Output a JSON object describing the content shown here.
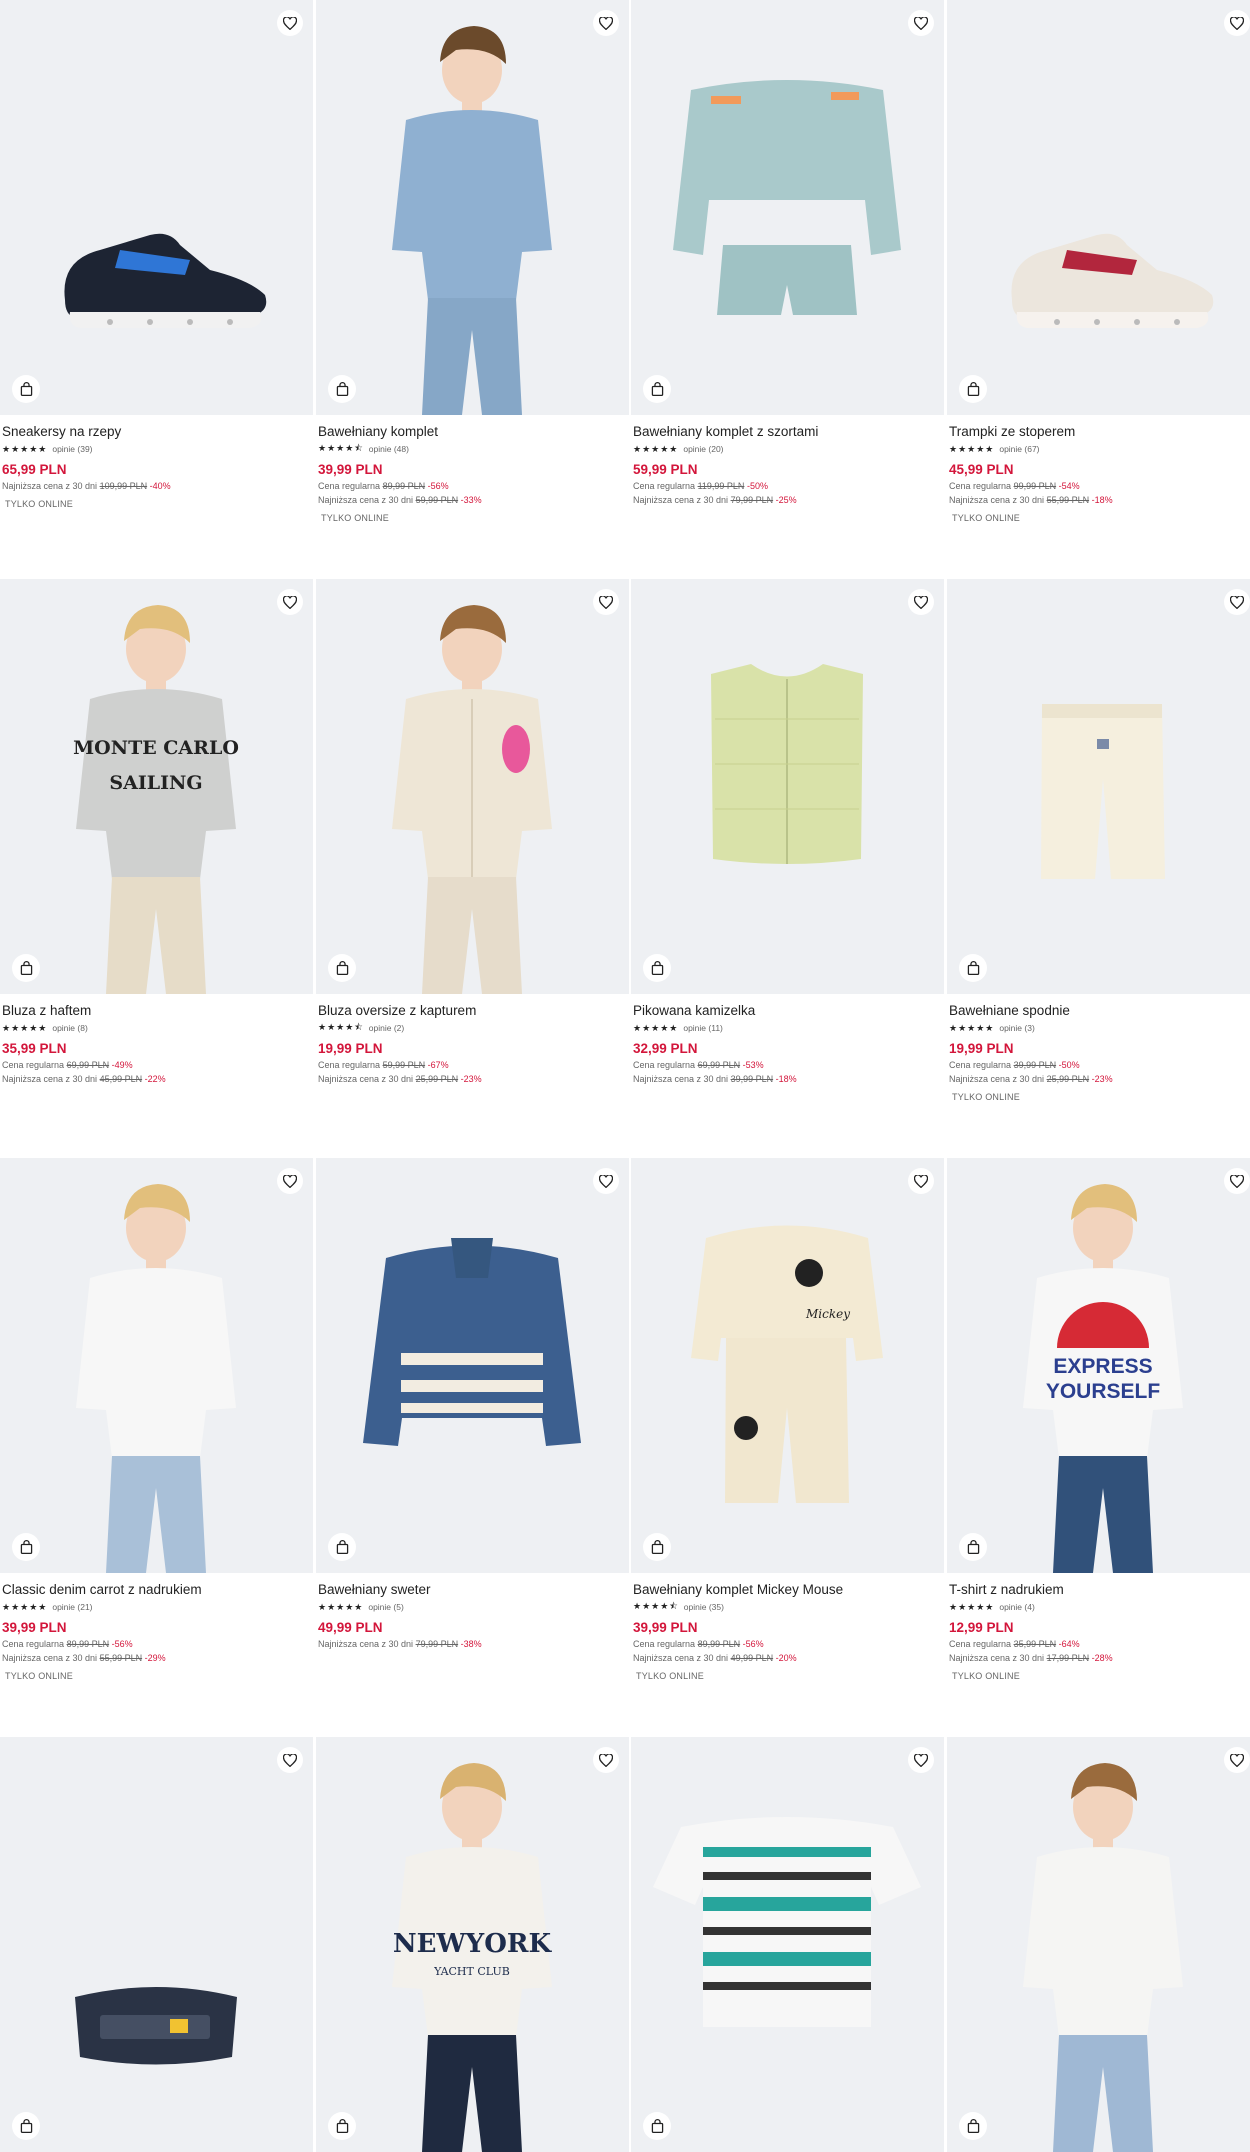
{
  "products": [
    {
      "title": "Sneakersy na rzepy",
      "stars": "★★★★★",
      "reviews": "opinie (39)",
      "price": "65,99 PLN",
      "regular_label": "",
      "regular_old": "",
      "regular_disc": "",
      "lowest_label": "Najniższa cena z 30 dni",
      "lowest_old": "109,99 PLN",
      "lowest_disc": "-40%",
      "badge": "TYLKO ONLINE",
      "art": "sneaker-blue"
    },
    {
      "title": "Bawełniany komplet",
      "stars": "★★★★⯪",
      "reviews": "opinie (48)",
      "price": "39,99 PLN",
      "regular_label": "Cena regularna",
      "regular_old": "89,99 PLN",
      "regular_disc": "-56%",
      "lowest_label": "Najniższa cena z 30 dni",
      "lowest_old": "59,99 PLN",
      "lowest_disc": "-33%",
      "badge": "TYLKO ONLINE",
      "art": "boy-blue-set"
    },
    {
      "title": "Bawełniany komplet z szortami",
      "stars": "★★★★★",
      "reviews": "opinie (20)",
      "price": "59,99 PLN",
      "regular_label": "Cena regularna",
      "regular_old": "119,99 PLN",
      "regular_disc": "-50%",
      "lowest_label": "Najniższa cena z 30 dni",
      "lowest_old": "79,99 PLN",
      "lowest_disc": "-25%",
      "badge": "",
      "art": "mint-set"
    },
    {
      "title": "Trampki ze stoperem",
      "stars": "★★★★★",
      "reviews": "opinie (67)",
      "price": "45,99 PLN",
      "regular_label": "Cena regularna",
      "regular_old": "99,99 PLN",
      "regular_disc": "-54%",
      "lowest_label": "Najniższa cena z 30 dni",
      "lowest_old": "55,99 PLN",
      "lowest_disc": "-18%",
      "badge": "TYLKO ONLINE",
      "art": "sneaker-white"
    },
    {
      "title": "Bluza z haftem",
      "stars": "★★★★★",
      "reviews": "opinie (8)",
      "price": "35,99 PLN",
      "regular_label": "Cena regularna",
      "regular_old": "69,99 PLN",
      "regular_disc": "-49%",
      "lowest_label": "Najniższa cena z 30 dni",
      "lowest_old": "45,99 PLN",
      "lowest_disc": "-22%",
      "badge": "",
      "art": "boy-grey-sweat"
    },
    {
      "title": "Bluza oversize z kapturem",
      "stars": "★★★★⯪",
      "reviews": "opinie (2)",
      "price": "19,99 PLN",
      "regular_label": "Cena regularna",
      "regular_old": "59,99 PLN",
      "regular_disc": "-67%",
      "lowest_label": "Najniższa cena z 30 dni",
      "lowest_old": "25,99 PLN",
      "lowest_disc": "-23%",
      "badge": "",
      "art": "boy-hoodie"
    },
    {
      "title": "Pikowana kamizelka",
      "stars": "★★★★★",
      "reviews": "opinie (11)",
      "price": "32,99 PLN",
      "regular_label": "Cena regularna",
      "regular_old": "69,99 PLN",
      "regular_disc": "-53%",
      "lowest_label": "Najniższa cena z 30 dni",
      "lowest_old": "39,99 PLN",
      "lowest_disc": "-18%",
      "badge": "",
      "art": "vest"
    },
    {
      "title": "Bawełniane spodnie",
      "stars": "★★★★★",
      "reviews": "opinie (3)",
      "price": "19,99 PLN",
      "regular_label": "Cena regularna",
      "regular_old": "39,99 PLN",
      "regular_disc": "-50%",
      "lowest_label": "Najniższa cena z 30 dni",
      "lowest_old": "25,99 PLN",
      "lowest_disc": "-23%",
      "badge": "TYLKO ONLINE",
      "art": "pants"
    },
    {
      "title": "Classic denim carrot z nadrukiem",
      "stars": "★★★★★",
      "reviews": "opinie (21)",
      "price": "39,99 PLN",
      "regular_label": "Cena regularna",
      "regular_old": "89,99 PLN",
      "regular_disc": "-56%",
      "lowest_label": "Najniższa cena z 30 dni",
      "lowest_old": "55,99 PLN",
      "lowest_disc": "-29%",
      "badge": "TYLKO ONLINE",
      "art": "jeans"
    },
    {
      "title": "Bawełniany sweter",
      "stars": "★★★★★",
      "reviews": "opinie (5)",
      "price": "49,99 PLN",
      "regular_label": "",
      "regular_old": "",
      "regular_disc": "",
      "lowest_label": "Najniższa cena z 30 dni",
      "lowest_old": "79,99 PLN",
      "lowest_disc": "-38%",
      "badge": "",
      "art": "sweater"
    },
    {
      "title": "Bawełniany komplet Mickey Mouse",
      "stars": "★★★★⯪",
      "reviews": "opinie (35)",
      "price": "39,99 PLN",
      "regular_label": "Cena regularna",
      "regular_old": "89,99 PLN",
      "regular_disc": "-56%",
      "lowest_label": "Najniższa cena z 30 dni",
      "lowest_old": "49,99 PLN",
      "lowest_disc": "-20%",
      "badge": "TYLKO ONLINE",
      "art": "mickey-set"
    },
    {
      "title": "T-shirt z nadrukiem",
      "stars": "★★★★★",
      "reviews": "opinie (4)",
      "price": "12,99 PLN",
      "regular_label": "Cena regularna",
      "regular_old": "35,99 PLN",
      "regular_disc": "-64%",
      "lowest_label": "Najniższa cena z 30 dni",
      "lowest_old": "17,99 PLN",
      "lowest_disc": "-28%",
      "badge": "TYLKO ONLINE",
      "art": "boy-tshirt"
    },
    {
      "title": "",
      "stars": "",
      "reviews": "",
      "price": "",
      "regular_label": "",
      "regular_old": "",
      "regular_disc": "",
      "lowest_label": "",
      "lowest_old": "",
      "lowest_disc": "",
      "badge": "",
      "art": "bag"
    },
    {
      "title": "",
      "stars": "",
      "reviews": "",
      "price": "",
      "regular_label": "",
      "regular_old": "",
      "regular_disc": "",
      "lowest_label": "",
      "lowest_old": "",
      "lowest_disc": "",
      "badge": "",
      "art": "boy-newyork"
    },
    {
      "title": "",
      "stars": "",
      "reviews": "",
      "price": "",
      "regular_label": "",
      "regular_old": "",
      "regular_disc": "",
      "lowest_label": "",
      "lowest_old": "",
      "lowest_disc": "",
      "badge": "",
      "art": "striped-tee"
    },
    {
      "title": "",
      "stars": "",
      "reviews": "",
      "price": "",
      "regular_label": "",
      "regular_old": "",
      "regular_disc": "",
      "lowest_label": "",
      "lowest_old": "",
      "lowest_disc": "",
      "badge": "",
      "art": "boy-white-tee"
    }
  ],
  "print_texts": {
    "monte_carlo": "MONTE CARLO",
    "sailing": "SAILING",
    "express": "EXPRESS",
    "yourself": "YOURSELF",
    "newyork": "NEWYORK",
    "yacht": "YACHT CLUB",
    "mickey": "Mickey"
  },
  "icons": {
    "wishlist": "heart-icon",
    "add_to_cart": "bag-icon"
  },
  "colors": {
    "price": "#d3163b",
    "image_bg": "#eef0f3"
  }
}
